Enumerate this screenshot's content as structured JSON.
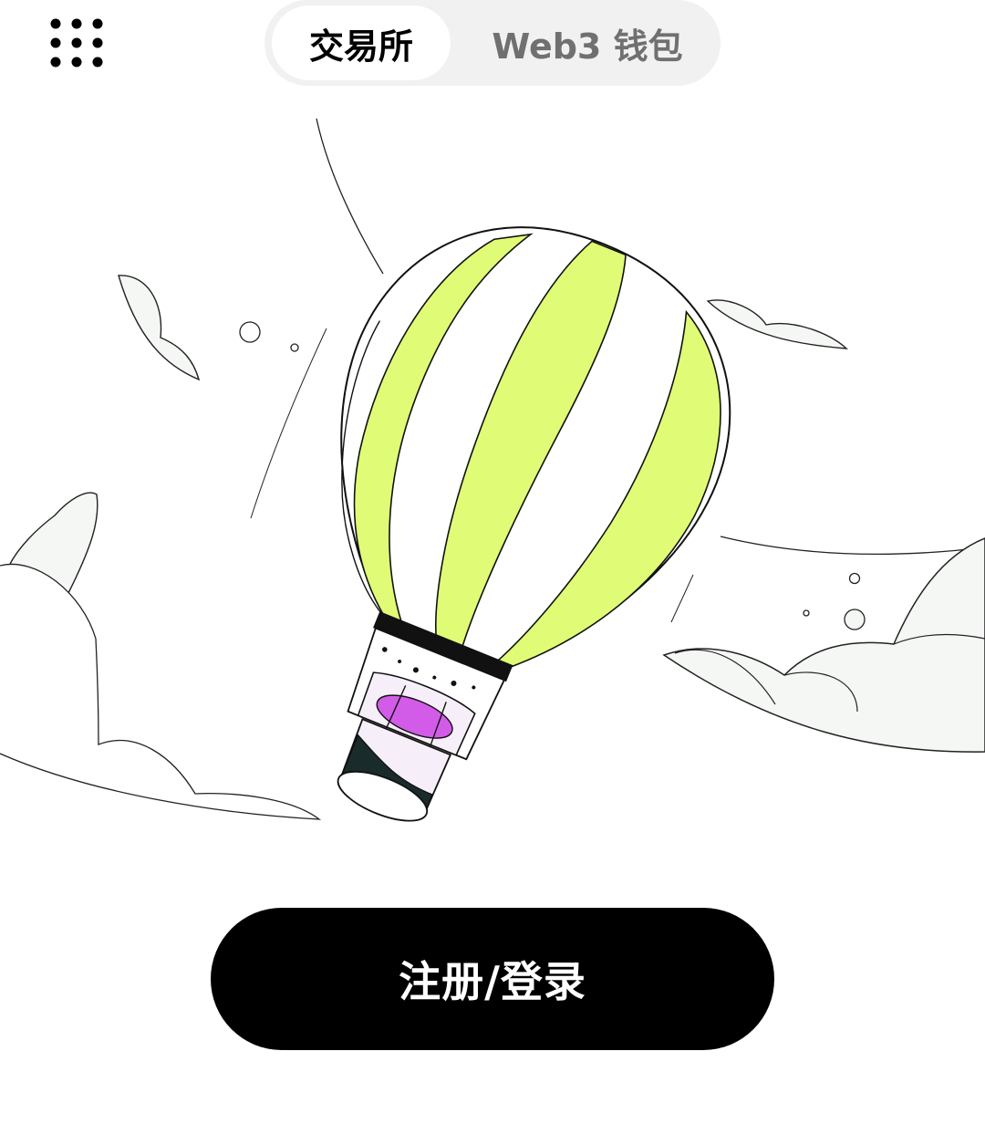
{
  "header": {
    "menu_icon": "grid-dots-icon",
    "tabs": [
      {
        "label": "交易所",
        "active": true
      },
      {
        "label": "Web3 钱包",
        "active": false
      }
    ]
  },
  "illustration": {
    "subject": "hot-air-balloon",
    "colors": {
      "stripe": "#e0fc76",
      "accent": "#d25ce8",
      "accent_light": "#f6eef9",
      "dark": "#1a2b2b",
      "cloud_fill": "#f5f7f5"
    }
  },
  "cta": {
    "label": "注册/登录",
    "background": "#000000",
    "text_color": "#ffffff"
  }
}
